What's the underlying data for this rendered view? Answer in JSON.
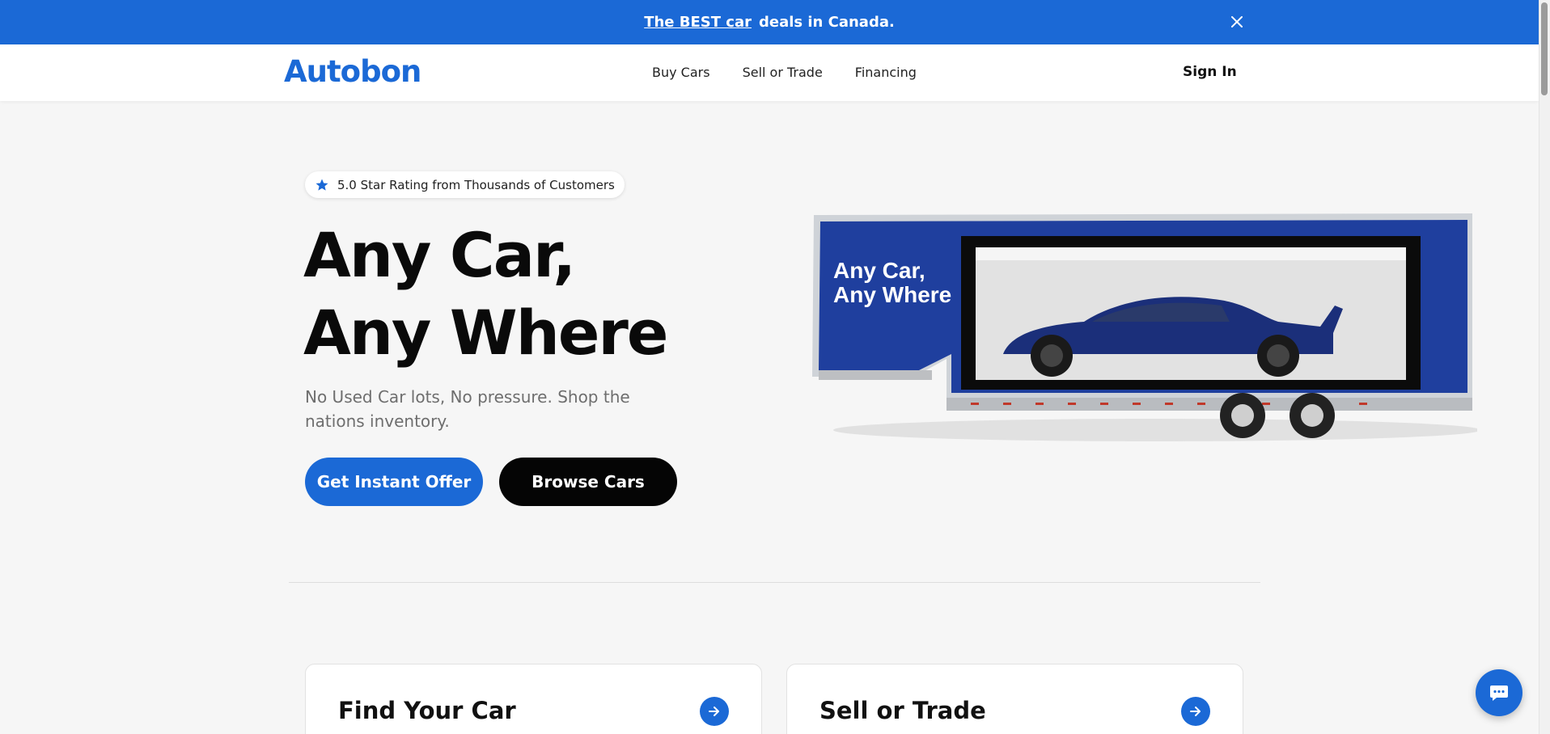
{
  "banner": {
    "link_text": "The BEST car",
    "text": "deals in Canada."
  },
  "nav": {
    "logo": "Autobon",
    "links": [
      "Buy Cars",
      "Sell or Trade",
      "Financing"
    ],
    "signin": "Sign In"
  },
  "hero": {
    "rating": "5.0 Star Rating from Thousands of Customers",
    "title_line1": "Any Car,",
    "title_line2": "Any Where",
    "subtitle": "No Used Car lots, No pressure. Shop the nations inventory.",
    "primary_button": "Get Instant Offer",
    "secondary_button": "Browse Cars",
    "trailer_text_line1": "Any Car,",
    "trailer_text_line2": "Any Where"
  },
  "cards": [
    {
      "title": "Find Your Car"
    },
    {
      "title": "Sell or Trade"
    }
  ],
  "colors": {
    "brand": "#1b69d6",
    "dark_button": "#050505",
    "background": "#f6f6f6"
  },
  "icons": {
    "rating": "star-icon",
    "banner_close": "close-icon",
    "card_arrow": "arrow-right-icon",
    "chat": "chat-icon"
  }
}
